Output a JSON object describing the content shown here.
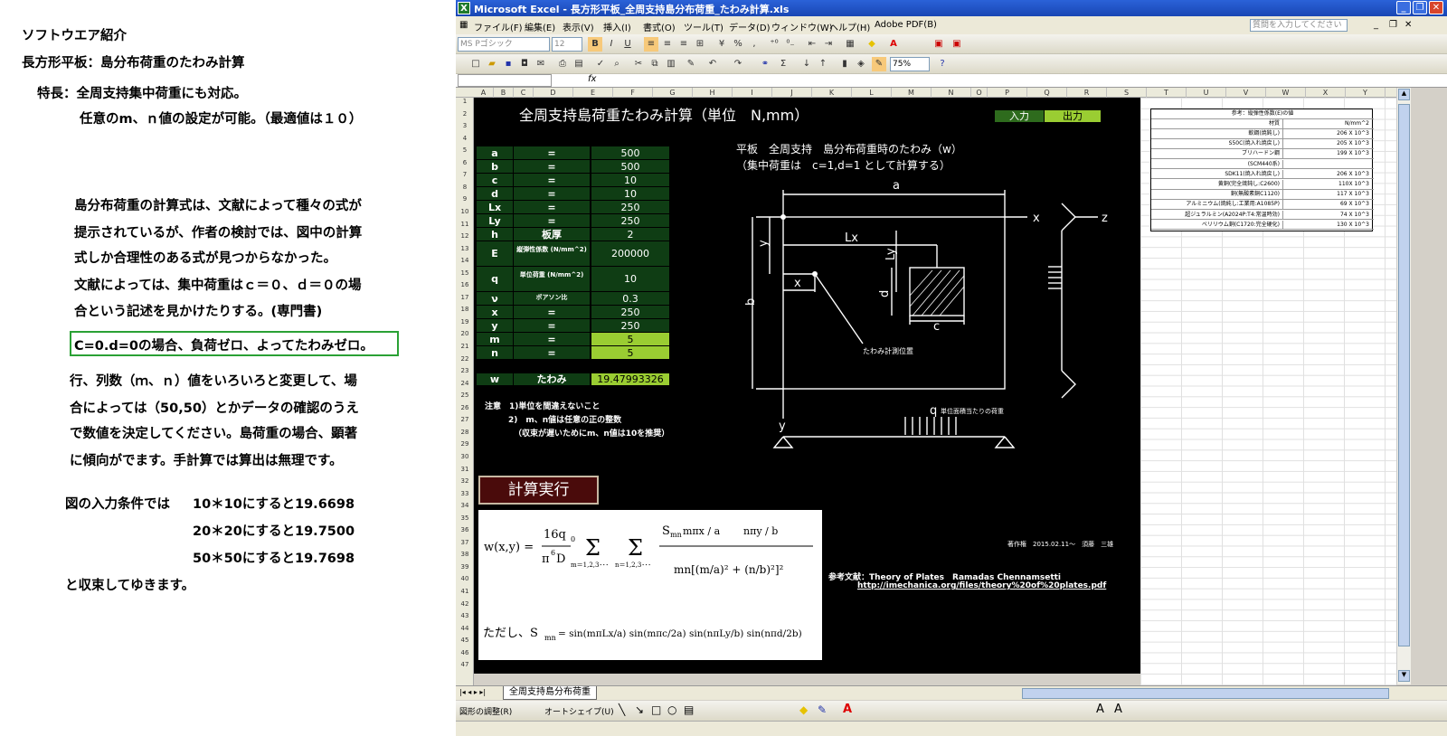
{
  "article": {
    "heading": "ソフトウエア紹介",
    "subheading": "長方形平板：島分布荷重のたわみ計算",
    "feature1": "特長：全周支持集中荷重にも対応。",
    "feature2": "任意のm、ｎ値の設定が可能。（最適値は１０）",
    "para1": [
      "島分布荷重の計算式は、文献によって種々の式が",
      "提示されているが、作者の検討では、図中の計算",
      "式しか合理性のある式が見つからなかった。",
      "文献によっては、集中荷重はｃ＝０、ｄ＝０の場",
      "合という記述を見かけたりする。(専門書)"
    ],
    "note": "C=0.d=0の場合、負荷ゼロ、よってたわみゼロ。",
    "para2": [
      "行、列数（ｍ、ｎ）値をいろいろと変更して、場",
      "合によっては（50,50）とかデータの確認のうえ",
      "で数値を決定してください。島荷重の場合、顕著",
      "に傾向がでます。手計算では算出は無理です。"
    ],
    "result_intro": "図の入力条件では",
    "results": [
      "10＊10にすると19.6698",
      "20＊20にすると19.7500",
      "50＊50にすると19.7698"
    ],
    "closing": "と収束してゆきます。"
  },
  "excel": {
    "title": "Microsoft Excel - 長方形平板_全周支持島分布荷重_たわみ計算.xls",
    "menu": [
      "ファイル(F)",
      "編集(E)",
      "表示(V)",
      "挿入(I)",
      "書式(O)",
      "ツール(T)",
      "データ(D)",
      "ウィンドウ(W)",
      "ヘルプ(H)",
      "Adobe PDF(B)"
    ],
    "ask_placeholder": "質問を入力してください",
    "font_name": "MS Pゴシック",
    "font_size": "12",
    "zoom": "75%",
    "fx": "fx",
    "columns": [
      "A",
      "B",
      "C",
      "D",
      "E",
      "F",
      "G",
      "H",
      "I",
      "J",
      "K",
      "L",
      "M",
      "N",
      "O",
      "P",
      "Q",
      "R",
      "S",
      "T",
      "U",
      "V",
      "W",
      "X",
      "Y"
    ],
    "sheet_tab": "全周支持島分布荷重",
    "draw_toolbar": {
      "adjust": "図形の調整(R)",
      "autoshape": "オートシェイプ(U)"
    }
  },
  "sheet": {
    "title": "全周支持島荷重たわみ計算（単位　N,mm）",
    "input_label": "入力",
    "output_label": "出力",
    "params": [
      {
        "name": "a",
        "label": "=",
        "value": "500"
      },
      {
        "name": "b",
        "label": "=",
        "value": "500"
      },
      {
        "name": "c",
        "label": "=",
        "value": "10"
      },
      {
        "name": "d",
        "label": "=",
        "value": "10"
      },
      {
        "name": "Lx",
        "label": "=",
        "value": "250"
      },
      {
        "name": "Ly",
        "label": "=",
        "value": "250"
      },
      {
        "name": "h",
        "label": "板厚",
        "value": "2"
      },
      {
        "name": "E",
        "label": "縦弾性係数 (N/mm^2)",
        "value": "200000"
      },
      {
        "name": "q",
        "label": "単位荷重 (N/mm^2)",
        "value": "10"
      },
      {
        "name": "ν",
        "label": "ポアソン比",
        "value": "0.3"
      },
      {
        "name": "x",
        "label": "=",
        "value": "250"
      },
      {
        "name": "y",
        "label": "=",
        "value": "250"
      },
      {
        "name": "m",
        "label": "=",
        "value": "5"
      },
      {
        "name": "n",
        "label": "=",
        "value": "5"
      }
    ],
    "result": {
      "name": "w",
      "label": "たわみ",
      "value": "19.47993326"
    },
    "notes": [
      "注意　1)単位を間違えないこと",
      "2)　m、n値は任意の正の整数",
      "（収束が遅いためにm、n値は10を推奨）"
    ],
    "run_button": "計算実行",
    "diagram_title1": "平板　全周支持　島分布荷重時のたわみ（w）",
    "diagram_title2": "（集中荷重は　c=1,d=1 として計算する）",
    "diagram_labels": {
      "a": "a",
      "b": "b",
      "c": "c",
      "d": "d",
      "Lx": "Lx",
      "Ly": "Ly",
      "x": "x",
      "y": "y",
      "X": "x",
      "Y": "y",
      "Z": "z",
      "q": "q",
      "q_note": "単位面積当たりの荷重",
      "measure": "たわみ計測位置"
    },
    "copyright": "著作権　2015.02.11～　須藤　三雄",
    "reference_label": "参考文献：Theory of Plates　Ramadas Chennamsetti",
    "reference_url": "http://imechanica.org/files/theory%20of%20plates.pdf",
    "formula": {
      "lhs": "w(x,y) =",
      "coef_num": "16q",
      "coef_num_sub": "0",
      "coef_den": "π",
      "coef_den_sup": "6",
      "coef_den_tail": "D",
      "sum1": "m＝1,2,3･･･",
      "sum2": "n＝1,2,3･･･",
      "num": "S",
      "num_sub": "mn",
      "sin1": "mπx / a",
      "sin2": "nπy / b",
      "den": "mn[(m/a)² + (n/b)²]²",
      "tadashi": "ただし、S",
      "tadashi_sub": "mn",
      "tadashi_rhs": "= sin(mπLx/a) sin(mπc/2a) sin(nπLy/b) sin(nπd/2b)"
    }
  },
  "ref_table": {
    "title": "参考：縦弾性係数(E)の値",
    "header": [
      "材質",
      "N/mm^2"
    ],
    "rows": [
      [
        "軟鋼(焼鈍し)",
        "206 X 10^3"
      ],
      [
        "S50C(焼入れ焼戻し)",
        "205 X 10^3"
      ],
      [
        "ブリハードン鋼",
        "199 X 10^3"
      ],
      [
        "(SCM440系)",
        ""
      ],
      [
        "SDK11(焼入れ焼戻し)",
        "206 X 10^3"
      ],
      [
        "黄銅(完全焼鈍し:C2600)",
        "110X 10^3"
      ],
      [
        "銅(無酸素銅C1120)",
        "117 X 10^3"
      ],
      [
        "アルミニウム(焼純し:工業用:A1085P)",
        "69 X 10^3"
      ],
      [
        "超ジュラルミン(A2024P:T4:常温時効)",
        "74 X 10^3"
      ],
      [
        "ベリリウム銅(C1720:完全硬化)",
        "130 X 10^3"
      ]
    ]
  }
}
